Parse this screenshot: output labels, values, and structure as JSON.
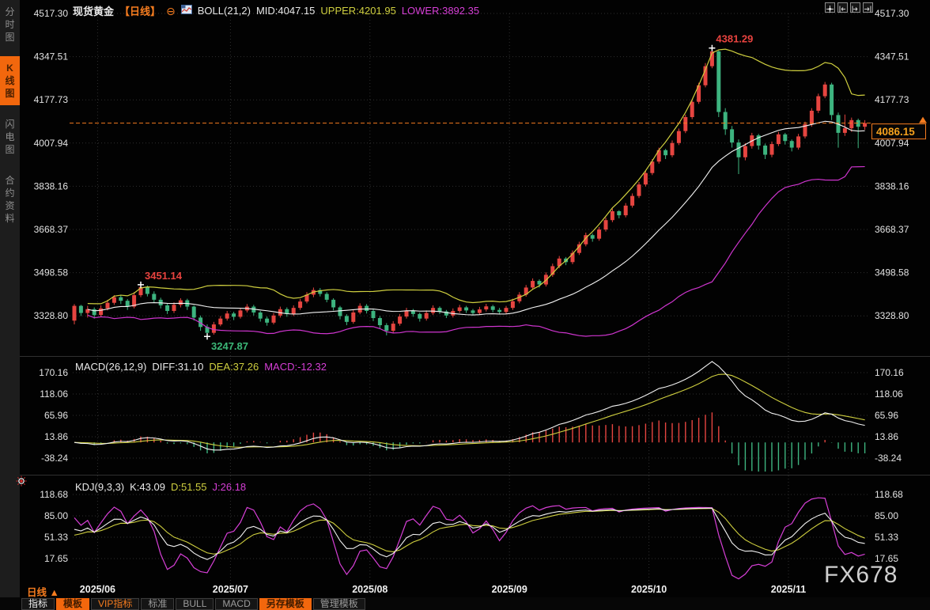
{
  "sidebar": {
    "items": [
      {
        "label": "分时图",
        "name": "minute-chart",
        "active": false
      },
      {
        "label": "K线图",
        "name": "kline-chart",
        "active": true
      },
      {
        "label": "闪电图",
        "name": "flash-chart",
        "active": false
      },
      {
        "label": "合约资料",
        "name": "contract-info",
        "active": false
      }
    ]
  },
  "header": {
    "symbol": "现货黄金",
    "period": "【日线】",
    "boll_label": "BOLL(21,2)",
    "mid": "MID:4047.15",
    "upper": "UPPER:4201.95",
    "lower": "LOWER:3892.35"
  },
  "macd_header": {
    "label": "MACD(26,12,9)",
    "diff": "DIFF:31.10",
    "dea": "DEA:37.26",
    "macd": "MACD:-12.32"
  },
  "kdj_header": {
    "label": "KDJ(9,3,3)",
    "k": "K:43.09",
    "d": "D:51.55",
    "j": "J:26.18"
  },
  "xaxis": {
    "period_label": "日线",
    "period_arrow": "▲"
  },
  "toolbar": {
    "items": [
      {
        "label": "指标",
        "name": "indicators",
        "style": "plain"
      },
      {
        "label": "模板",
        "name": "template",
        "style": "active"
      },
      {
        "label": "VIP指标",
        "name": "vip-indicators",
        "style": "vip"
      },
      {
        "label": "标准",
        "name": "standard",
        "style": "dim"
      },
      {
        "label": "BULL",
        "name": "bull",
        "style": "dim"
      },
      {
        "label": "MACD",
        "name": "macd",
        "style": "dim"
      },
      {
        "label": "另存模板",
        "name": "save-template",
        "style": "active"
      },
      {
        "label": "管理模板",
        "name": "manage-templates",
        "style": "dim"
      }
    ]
  },
  "watermark": "FX678",
  "colors": {
    "up": "#e64540",
    "down": "#3db47f",
    "boll_mid": "#f2f2f2",
    "boll_upper": "#cfcf3f",
    "boll_lower": "#cf35cf",
    "accent_orange": "#f57c1f",
    "price_box_text": "#f5a11d",
    "grid": "#2f2f2f",
    "axis_text": "#e3e3e3",
    "k_line": "#f2f2f2",
    "d_line": "#cfcf3f",
    "j_line": "#d63fd6",
    "ann_high": "#e8433f",
    "ann_low": "#3cb878"
  },
  "chart_data": {
    "type": "candlestick",
    "title": "现货黄金 日线",
    "price_axis": [
      "4517.30",
      "4347.51",
      "4177.73",
      "4007.94",
      "3838.16",
      "3668.37",
      "3498.58",
      "3328.80"
    ],
    "macd_axis": [
      "170.16",
      "118.06",
      "65.96",
      "13.86",
      "-38.24"
    ],
    "kdj_axis": [
      "118.68",
      "85.00",
      "51.33",
      "17.65"
    ],
    "months": [
      {
        "label": "2025/06",
        "index": 3.5
      },
      {
        "label": "2025/07",
        "index": 23.5
      },
      {
        "label": "2025/08",
        "index": 44.5
      },
      {
        "label": "2025/09",
        "index": 65.5
      },
      {
        "label": "2025/10",
        "index": 86.5
      },
      {
        "label": "2025/11",
        "index": 107.5
      }
    ],
    "boll": {
      "period": 21,
      "mult": 2
    },
    "macd": {
      "fast": 12,
      "slow": 26,
      "signal": 9
    },
    "kdj": {
      "n": 9,
      "m1": 3,
      "m2": 3
    },
    "current_price": {
      "value": 4086.15,
      "label": "4086.15"
    },
    "annotations": [
      {
        "index": 10,
        "price": 3451.14,
        "label": "3451.14",
        "position": "above",
        "color": "#e8433f"
      },
      {
        "index": 20,
        "price": 3247.87,
        "label": "3247.87",
        "position": "below",
        "color": "#3cb878"
      },
      {
        "index": 96,
        "price": 4381.29,
        "label": "4381.29",
        "position": "above",
        "color": "#e8433f"
      }
    ],
    "candles": [
      [
        3310,
        3375,
        3295,
        3368
      ],
      [
        3368,
        3372,
        3328,
        3340
      ],
      [
        3340,
        3368,
        3322,
        3355
      ],
      [
        3355,
        3362,
        3318,
        3332
      ],
      [
        3332,
        3370,
        3325,
        3358
      ],
      [
        3358,
        3392,
        3350,
        3380
      ],
      [
        3380,
        3410,
        3372,
        3402
      ],
      [
        3402,
        3412,
        3375,
        3388
      ],
      [
        3388,
        3395,
        3352,
        3365
      ],
      [
        3365,
        3422,
        3358,
        3410
      ],
      [
        3410,
        3451.14,
        3402,
        3442
      ],
      [
        3442,
        3448,
        3405,
        3415
      ],
      [
        3415,
        3425,
        3380,
        3392
      ],
      [
        3392,
        3400,
        3358,
        3370
      ],
      [
        3370,
        3378,
        3336,
        3348
      ],
      [
        3348,
        3382,
        3340,
        3372
      ],
      [
        3372,
        3398,
        3362,
        3390
      ],
      [
        3390,
        3396,
        3352,
        3365
      ],
      [
        3365,
        3370,
        3310,
        3322
      ],
      [
        3322,
        3330,
        3270,
        3285
      ],
      [
        3285,
        3295,
        3247.87,
        3262
      ],
      [
        3262,
        3305,
        3255,
        3295
      ],
      [
        3295,
        3328,
        3288,
        3318
      ],
      [
        3318,
        3348,
        3310,
        3338
      ],
      [
        3338,
        3345,
        3312,
        3325
      ],
      [
        3325,
        3360,
        3318,
        3350
      ],
      [
        3350,
        3375,
        3342,
        3365
      ],
      [
        3365,
        3372,
        3330,
        3342
      ],
      [
        3342,
        3348,
        3306,
        3318
      ],
      [
        3318,
        3326,
        3290,
        3302
      ],
      [
        3302,
        3340,
        3295,
        3330
      ],
      [
        3330,
        3365,
        3322,
        3355
      ],
      [
        3355,
        3362,
        3325,
        3336
      ],
      [
        3336,
        3370,
        3328,
        3360
      ],
      [
        3360,
        3395,
        3352,
        3385
      ],
      [
        3385,
        3422,
        3378,
        3412
      ],
      [
        3412,
        3440,
        3402,
        3430
      ],
      [
        3430,
        3438,
        3405,
        3415
      ],
      [
        3415,
        3422,
        3382,
        3392
      ],
      [
        3392,
        3398,
        3350,
        3362
      ],
      [
        3362,
        3368,
        3315,
        3328
      ],
      [
        3328,
        3335,
        3292,
        3305
      ],
      [
        3305,
        3352,
        3298,
        3342
      ],
      [
        3342,
        3378,
        3335,
        3368
      ],
      [
        3368,
        3375,
        3338,
        3348
      ],
      [
        3348,
        3355,
        3308,
        3320
      ],
      [
        3320,
        3328,
        3280,
        3292
      ],
      [
        3292,
        3300,
        3252,
        3270
      ],
      [
        3270,
        3308,
        3262,
        3298
      ],
      [
        3298,
        3336,
        3290,
        3326
      ],
      [
        3326,
        3360,
        3318,
        3350
      ],
      [
        3350,
        3356,
        3325,
        3336
      ],
      [
        3336,
        3342,
        3306,
        3318
      ],
      [
        3318,
        3350,
        3310,
        3340
      ],
      [
        3340,
        3370,
        3332,
        3360
      ],
      [
        3360,
        3366,
        3336,
        3346
      ],
      [
        3346,
        3352,
        3320,
        3330
      ],
      [
        3330,
        3358,
        3322,
        3348
      ],
      [
        3348,
        3372,
        3340,
        3362
      ],
      [
        3362,
        3368,
        3340,
        3350
      ],
      [
        3350,
        3356,
        3330,
        3340
      ],
      [
        3340,
        3364,
        3332,
        3354
      ],
      [
        3354,
        3376,
        3346,
        3366
      ],
      [
        3366,
        3372,
        3342,
        3352
      ],
      [
        3352,
        3360,
        3334,
        3344
      ],
      [
        3344,
        3368,
        3336,
        3360
      ],
      [
        3360,
        3396,
        3352,
        3386
      ],
      [
        3386,
        3422,
        3378,
        3412
      ],
      [
        3412,
        3450,
        3404,
        3440
      ],
      [
        3440,
        3476,
        3432,
        3466
      ],
      [
        3466,
        3472,
        3440,
        3452
      ],
      [
        3452,
        3500,
        3444,
        3490
      ],
      [
        3490,
        3534,
        3482,
        3524
      ],
      [
        3524,
        3564,
        3516,
        3554
      ],
      [
        3554,
        3560,
        3528,
        3540
      ],
      [
        3540,
        3586,
        3532,
        3576
      ],
      [
        3576,
        3620,
        3568,
        3610
      ],
      [
        3610,
        3656,
        3602,
        3646
      ],
      [
        3646,
        3652,
        3620,
        3632
      ],
      [
        3632,
        3678,
        3624,
        3668
      ],
      [
        3668,
        3715,
        3660,
        3705
      ],
      [
        3705,
        3750,
        3697,
        3740
      ],
      [
        3740,
        3744,
        3712,
        3724
      ],
      [
        3724,
        3772,
        3716,
        3762
      ],
      [
        3762,
        3810,
        3754,
        3800
      ],
      [
        3800,
        3855,
        3792,
        3845
      ],
      [
        3845,
        3900,
        3837,
        3890
      ],
      [
        3890,
        3945,
        3882,
        3935
      ],
      [
        3935,
        3990,
        3927,
        3980
      ],
      [
        3980,
        3985,
        3945,
        3960
      ],
      [
        3960,
        4018,
        3952,
        4008
      ],
      [
        4008,
        4065,
        4000,
        4055
      ],
      [
        4055,
        4120,
        4047,
        4110
      ],
      [
        4110,
        4180,
        4102,
        4170
      ],
      [
        4170,
        4245,
        4162,
        4235
      ],
      [
        4235,
        4322,
        4227,
        4310
      ],
      [
        4310,
        4381.29,
        4302,
        4368
      ],
      [
        4368,
        4372,
        4110,
        4130
      ],
      [
        4130,
        4145,
        4040,
        4062
      ],
      [
        4062,
        4075,
        3990,
        4010
      ],
      [
        4010,
        4022,
        3886,
        3952
      ],
      [
        3952,
        4008,
        3940,
        3996
      ],
      [
        3996,
        4048,
        3986,
        4038
      ],
      [
        4038,
        4044,
        3982,
        3998
      ],
      [
        3998,
        4006,
        3945,
        3962
      ],
      [
        3962,
        4014,
        3952,
        4004
      ],
      [
        4004,
        4052,
        3996,
        4042
      ],
      [
        4042,
        4048,
        4002,
        4016
      ],
      [
        4016,
        4022,
        3975,
        3990
      ],
      [
        3990,
        4044,
        3982,
        4034
      ],
      [
        4034,
        4092,
        4026,
        4082
      ],
      [
        4082,
        4145,
        4072,
        4135
      ],
      [
        4135,
        4202,
        4126,
        4192
      ],
      [
        4192,
        4248,
        4184,
        4238
      ],
      [
        4238,
        4245,
        4098,
        4118
      ],
      [
        4118,
        4128,
        3990,
        4048
      ],
      [
        4048,
        4120,
        4036,
        4066
      ],
      [
        4066,
        4108,
        4052,
        4098
      ],
      [
        4098,
        4104,
        3988,
        4072
      ],
      [
        4072,
        4098,
        4060,
        4086.15
      ]
    ]
  }
}
